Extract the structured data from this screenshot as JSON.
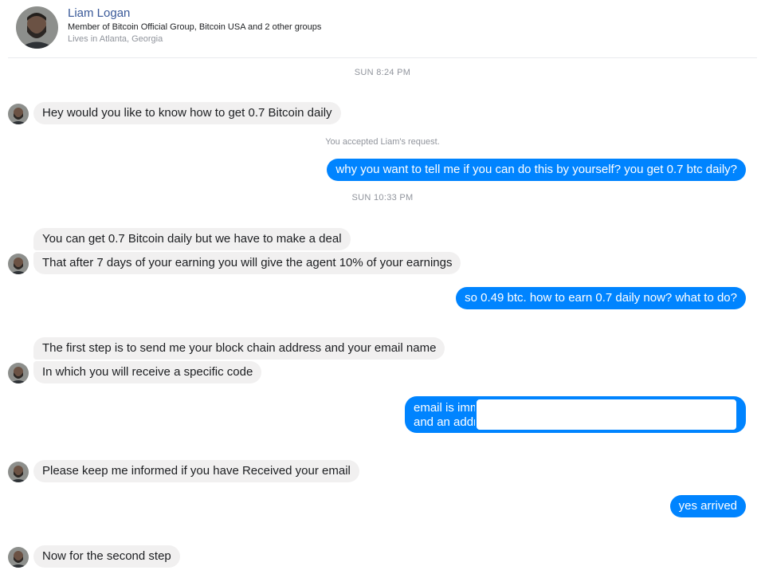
{
  "header": {
    "name": "Liam Logan",
    "groups": "Member of Bitcoin Official Group, Bitcoin USA and 2 other groups",
    "location": "Lives in Atlanta, Georgia"
  },
  "conversation": {
    "timestamp_1": "SUN 8:24 PM",
    "msg_1": "Hey would you like to know how to get 0.7 Bitcoin daily",
    "note_accepted": "You accepted Liam's request.",
    "msg_2": "why you want to tell me if you can do this by yourself? you get 0.7 btc daily?",
    "timestamp_2": "SUN 10:33 PM",
    "msg_3": "You can get 0.7 Bitcoin daily but we have to make a deal",
    "msg_4": "That after 7 days of your earning you will give the agent 10% of your earnings",
    "msg_5": "so 0.49 btc. how to earn 0.7 daily now? what to do?",
    "msg_6": "The first step is to send me your block chain address  and your email name",
    "msg_7": "In which you will receive a specific code",
    "msg_8_line1": "email is imm",
    "msg_8_line2": "and an addr",
    "msg_9": "Please keep me informed if you have Received your email",
    "msg_10": "yes arrived",
    "msg_11": "Now for the second step"
  },
  "colors": {
    "outgoing_bubble": "#0084ff",
    "incoming_bubble": "#f1f0f0",
    "name_link": "#385898"
  }
}
